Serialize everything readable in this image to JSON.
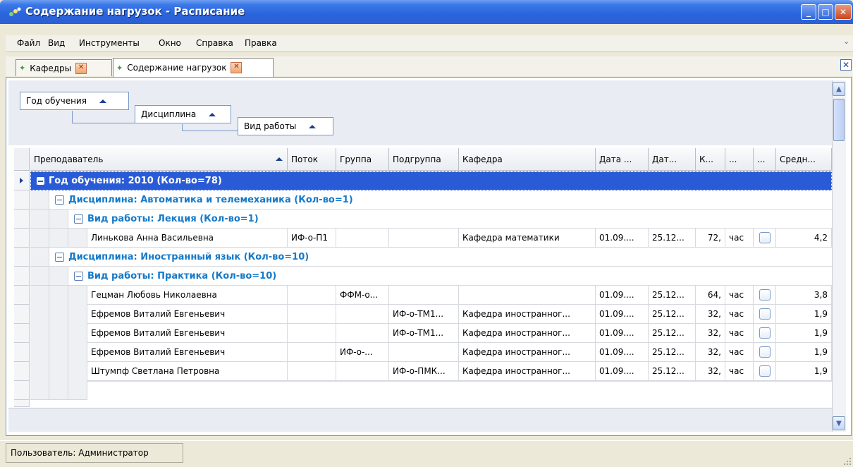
{
  "window": {
    "title": "Содержание нагрузок - Расписание",
    "buttons": {
      "minimize": "_",
      "maximize": "□",
      "close": "✕"
    }
  },
  "menu": [
    "Файл",
    "Вид",
    "Инструменты",
    "Окно",
    "Справка",
    "Правка"
  ],
  "tabs": [
    {
      "label": "Кафедры",
      "active": false
    },
    {
      "label": "Содержание нагрузок",
      "active": true
    }
  ],
  "grouping": [
    "Год обучения",
    "Дисциплина",
    "Вид работы"
  ],
  "columns": [
    "Преподаватель",
    "Поток",
    "Группа",
    "Подгруппа",
    "Кафедра",
    "Дата ...",
    "Дат...",
    "К...",
    "...",
    "...",
    "Средн..."
  ],
  "groups": {
    "year": "Год обучения: 2010 (Кол-во=78)",
    "disc1": "Дисциплина: Автоматика и телемеханика (Кол-во=1)",
    "work1": "Вид работы: Лекция (Кол-во=1)",
    "disc2": "Дисциплина: Иностранный язык (Кол-во=10)",
    "work2": "Вид работы: Практика (Кол-во=10)"
  },
  "rows": [
    {
      "teacher": "Линькова Анна Васильевна",
      "stream": "ИФ-о-П1",
      "group": "",
      "subgroup": "",
      "dept": "Кафедра математики",
      "date1": "01.09....",
      "date2": "25.12...",
      "k": "72,",
      "unit": "час",
      "avg": "4,2"
    },
    {
      "teacher": "Гецман Любовь Николаевна",
      "stream": "",
      "group": "ФФМ-о...",
      "subgroup": "",
      "dept": "",
      "date1": "01.09....",
      "date2": "25.12...",
      "k": "64,",
      "unit": "час",
      "avg": "3,8"
    },
    {
      "teacher": "Ефремов Виталий Евгеньевич",
      "stream": "",
      "group": "",
      "subgroup": "ИФ-о-ТМ1...",
      "dept": "Кафедра иностранног...",
      "date1": "01.09....",
      "date2": "25.12...",
      "k": "32,",
      "unit": "час",
      "avg": "1,9"
    },
    {
      "teacher": "Ефремов Виталий Евгеньевич",
      "stream": "",
      "group": "",
      "subgroup": "ИФ-о-ТМ1...",
      "dept": "Кафедра иностранног...",
      "date1": "01.09....",
      "date2": "25.12...",
      "k": "32,",
      "unit": "час",
      "avg": "1,9"
    },
    {
      "teacher": "Ефремов Виталий Евгеньевич",
      "stream": "",
      "group": "ИФ-о-...",
      "subgroup": "",
      "dept": "Кафедра иностранног...",
      "date1": "01.09....",
      "date2": "25.12...",
      "k": "32,",
      "unit": "час",
      "avg": "1,9"
    },
    {
      "teacher": "Штумпф Светлана Петровна",
      "stream": "",
      "group": "",
      "subgroup": "ИФ-о-ПМК...",
      "dept": "Кафедра иностранног...",
      "date1": "01.09....",
      "date2": "25.12...",
      "k": "32,",
      "unit": "час",
      "avg": "1,9"
    }
  ],
  "status": {
    "user": "Пользователь: Администратор"
  },
  "colors": {
    "accent": "#2a5bd7",
    "group_text": "#1479c9",
    "selected_row": "#2a5bd7"
  }
}
